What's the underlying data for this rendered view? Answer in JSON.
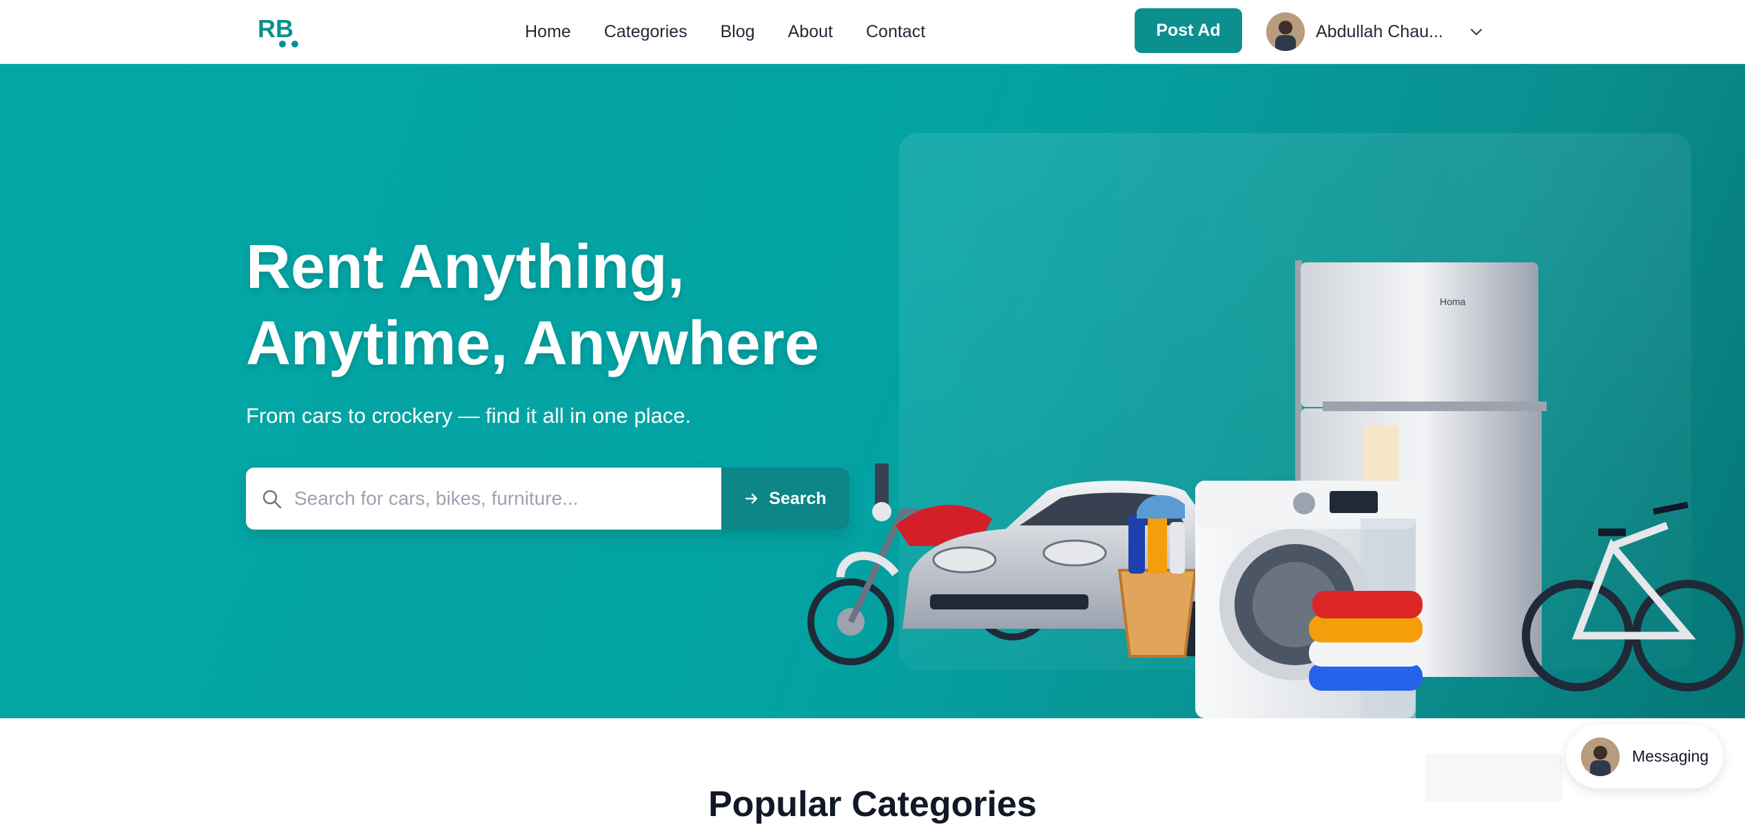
{
  "header": {
    "logo": "RB",
    "nav": [
      {
        "label": "Home"
      },
      {
        "label": "Categories"
      },
      {
        "label": "Blog"
      },
      {
        "label": "About"
      },
      {
        "label": "Contact"
      }
    ],
    "post_ad_label": "Post Ad",
    "user_name": "Abdullah Chau..."
  },
  "hero": {
    "title_line1": "Rent Anything,",
    "title_line2": "Anytime, Anywhere",
    "subtitle": "From cars to crockery — find it all in one place.",
    "search_placeholder": "Search for cars, bikes, furniture...",
    "search_button": "Search",
    "fridge_brand": "Homa"
  },
  "sections": {
    "popular_title": "Popular Categories"
  },
  "messaging": {
    "label": "Messaging"
  },
  "colors": {
    "brand": "#0c8f8f",
    "hero_bg": "#03a3a3"
  },
  "icons": [
    "logo-cart-icon",
    "chevron-down-icon",
    "search-icon",
    "arrow-right-icon"
  ]
}
